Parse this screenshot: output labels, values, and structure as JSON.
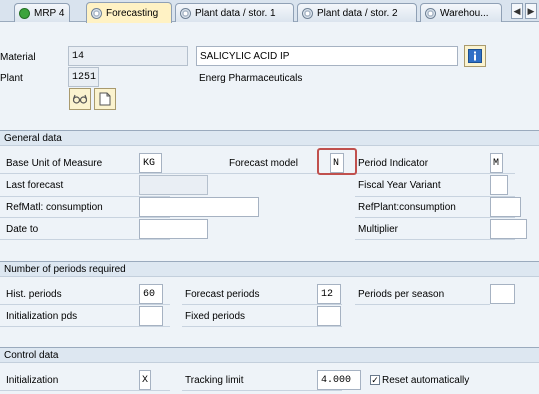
{
  "tabs": [
    {
      "label": "MRP 4",
      "icon": "check-icon"
    },
    {
      "label": "Forecasting",
      "icon": "tab-icon"
    },
    {
      "label": "Plant data / stor. 1",
      "icon": "tab-icon"
    },
    {
      "label": "Plant data / stor. 2",
      "icon": "tab-icon"
    },
    {
      "label": "Warehou...",
      "icon": "tab-icon"
    }
  ],
  "nav_buttons": [
    "◀",
    "▶"
  ],
  "header": {
    "material_label": "Material",
    "material_value": "14",
    "material_desc": "SALICYLIC ACID IP",
    "plant_label": "Plant",
    "plant_value": "1251",
    "plant_desc": "Energ Pharmaceuticals"
  },
  "general": {
    "title": "General data",
    "base_uom_label": "Base Unit of Measure",
    "base_uom_value": "KG",
    "forecast_model_label": "Forecast model",
    "forecast_model_value": "N",
    "period_indicator_label": "Period Indicator",
    "period_indicator_value": "M",
    "last_forecast_label": "Last forecast",
    "last_forecast_value": "",
    "fiscal_year_variant_label": "Fiscal Year Variant",
    "fiscal_year_variant_value": "",
    "ref_matl_label": "RefMatl: consumption",
    "ref_matl_value": "",
    "ref_plant_label": "RefPlant:consumption",
    "ref_plant_value": "",
    "date_to_label": "Date to",
    "date_to_value": "",
    "multiplier_label": "Multiplier",
    "multiplier_value": ""
  },
  "periods": {
    "title": "Number of periods required",
    "hist_label": "Hist. periods",
    "hist_value": "60",
    "forecast_label": "Forecast periods",
    "forecast_value": "12",
    "per_season_label": "Periods per season",
    "per_season_value": "",
    "init_pds_label": "Initialization pds",
    "init_pds_value": "",
    "fixed_label": "Fixed periods",
    "fixed_value": ""
  },
  "control": {
    "title": "Control data",
    "init_label": "Initialization",
    "init_value": "X",
    "tracking_label": "Tracking limit",
    "tracking_value": "4.000",
    "reset_label": "Reset automatically",
    "reset_checked": true,
    "check_mark": "✓"
  },
  "colors": {
    "accent": "#fff2c4",
    "highlight": "#c0504d"
  }
}
